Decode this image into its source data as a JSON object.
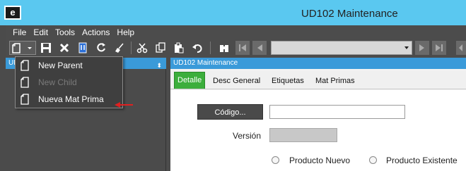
{
  "window": {
    "title": "UD102 Maintenance",
    "logo_letter": "e"
  },
  "menubar": {
    "items": [
      "File",
      "Edit",
      "Tools",
      "Actions",
      "Help"
    ]
  },
  "toolbar": {
    "icons": [
      "new-document-icon",
      "save-icon",
      "delete-icon",
      "attach-icon",
      "refresh-icon",
      "clear-icon",
      "cut-icon",
      "copy-icon",
      "paste-icon",
      "undo-icon",
      "search-binoculars-icon",
      "first-record-icon",
      "previous-record-icon",
      "next-record-icon",
      "last-record-icon"
    ],
    "nav_combo_value": ""
  },
  "left_panel": {
    "header": "UD"
  },
  "new_menu": {
    "items": [
      {
        "label": "New Parent",
        "enabled": true
      },
      {
        "label": "New Child",
        "enabled": false
      },
      {
        "label": "Nueva Mat Prima",
        "enabled": true
      }
    ]
  },
  "right_panel": {
    "header": "UD102 Maintenance",
    "tabs": [
      "Detalle",
      "Desc General",
      "Etiquetas",
      "Mat Primas"
    ],
    "active_tab": "Detalle"
  },
  "form": {
    "codigo_button": "Código...",
    "codigo_value": "",
    "version_label": "Versión",
    "version_value": "",
    "radio_options": [
      "Producto Nuevo",
      "Producto Existente"
    ]
  },
  "colors": {
    "titlebar": "#5ac8f0",
    "panel_header": "#3a9ad9",
    "active_tab": "#3cae3c",
    "annotation_arrow": "#e02020"
  }
}
